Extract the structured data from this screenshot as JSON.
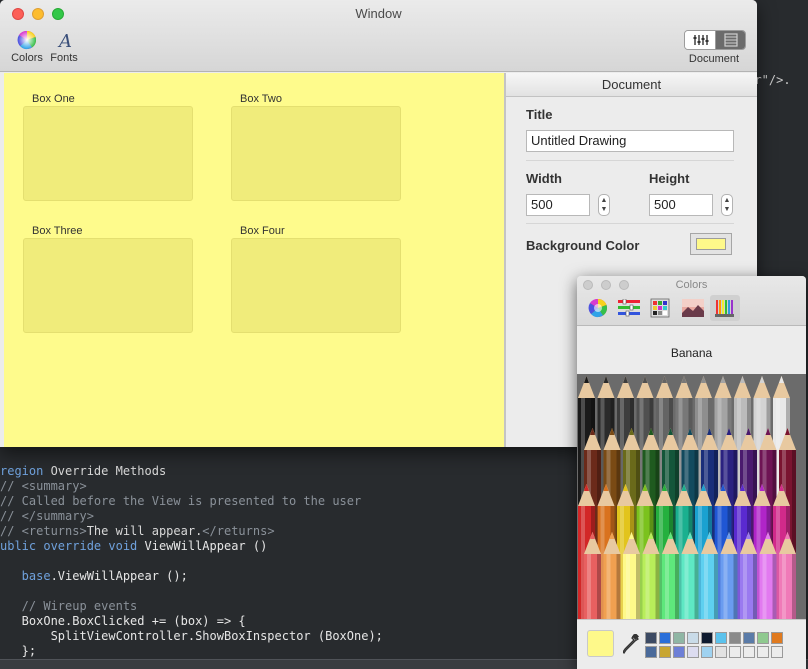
{
  "window": {
    "title": "Window",
    "toolbar": {
      "colors_label": "Colors",
      "fonts_label": "Fonts",
      "document_label": "Document"
    }
  },
  "canvas": {
    "background_color": "#fefb8c",
    "boxes": [
      {
        "label": "Box One"
      },
      {
        "label": "Box Two"
      },
      {
        "label": "Box Three"
      },
      {
        "label": "Box Four"
      }
    ]
  },
  "inspector": {
    "header": "Document",
    "title_label": "Title",
    "title_value": "Untitled Drawing",
    "width_label": "Width",
    "width_value": "500",
    "height_label": "Height",
    "height_value": "500",
    "background_color_label": "Background Color",
    "background_color_value": "#fef98a"
  },
  "colors_panel": {
    "title": "Colors",
    "modes": [
      "color-wheel",
      "color-sliders",
      "color-palettes",
      "image-palettes",
      "pencils"
    ],
    "selected_mode": "pencils",
    "selected_color_name": "Banana",
    "selected_color_value": "#fef98a",
    "swatches": [
      "#3c4a63",
      "#2a6fd9",
      "#8fb6a4",
      "#c9dbe8",
      "#0e1a2e",
      "#5bc2ec",
      "#8a8a8a",
      "#5a7ba8",
      "#8fc98f",
      "#e07a1f",
      "#4a6a9a",
      "#c8a631",
      "#6d7fd6",
      "#dcdcf0",
      "#9fd2f0",
      "#e2e2e2",
      "#ececec",
      "#ececec",
      "#ececec",
      "#ececec"
    ],
    "pencil_rows": [
      [
        "#1a1a1a",
        "#2b2b2b",
        "#3d3d3d",
        "#505050",
        "#646464",
        "#787878",
        "#8e8e8e",
        "#a4a4a4",
        "#bbbbbb",
        "#d3d3d3",
        "#e8e8e8"
      ],
      [
        "#6b2a1a",
        "#7a4a14",
        "#6a6a1a",
        "#1f5a1f",
        "#14563a",
        "#124a5e",
        "#1a2f7a",
        "#2a2180",
        "#4a1a6e",
        "#6e1454",
        "#7a1430"
      ],
      [
        "#d22727",
        "#d9721e",
        "#e2c41c",
        "#7bc21d",
        "#25b03e",
        "#1ab08f",
        "#1aa1d0",
        "#1f56d4",
        "#5a2ad0",
        "#b025c8",
        "#d12a8a"
      ],
      [
        "#e86060",
        "#f0a050",
        "#fef98a",
        "#b8ee5a",
        "#5ee87c",
        "#5ee8c4",
        "#5ed0f0",
        "#6a9cf0",
        "#9a7af0",
        "#e27af0",
        "#f07ab8"
      ]
    ]
  },
  "editor": {
    "top_fragment": "ler\"/>.",
    "lines": [
      [
        {
          "t": "region ",
          "c": "kw"
        },
        {
          "t": "Override Methods",
          "c": "ty"
        }
      ],
      [
        {
          "t": "// <summary>",
          "c": "cm"
        }
      ],
      [
        {
          "t": "// Called before the View is presented to the user",
          "c": "cm"
        }
      ],
      [
        {
          "t": "// </summary>",
          "c": "cm"
        }
      ],
      [
        {
          "t": "// <returns>",
          "c": "cm"
        },
        {
          "t": "The will appear.",
          "c": "ty"
        },
        {
          "t": "</returns>",
          "c": "cm"
        }
      ],
      [
        {
          "t": "ublic override void ",
          "c": "kw"
        },
        {
          "t": "ViewWillAppear ()",
          "c": "fn"
        }
      ],
      [
        {
          "t": "",
          "c": "ty"
        }
      ],
      [
        {
          "t": "   base",
          "c": "kw"
        },
        {
          "t": ".ViewWillAppear ();",
          "c": "fn"
        }
      ],
      [
        {
          "t": "",
          "c": "ty"
        }
      ],
      [
        {
          "t": "   // Wireup events",
          "c": "cm"
        }
      ],
      [
        {
          "t": "   BoxOne.BoxClicked += (box) => {",
          "c": "fn"
        }
      ],
      [
        {
          "t": "       SplitViewController.ShowBoxInspector (BoxOne);",
          "c": "fn"
        }
      ],
      [
        {
          "t": "   };",
          "c": "fn"
        }
      ]
    ]
  }
}
